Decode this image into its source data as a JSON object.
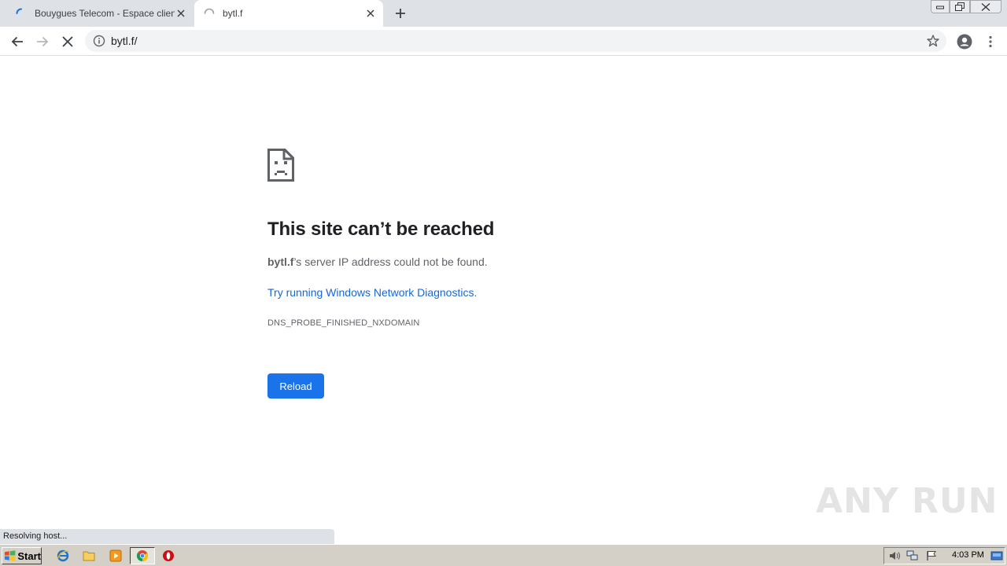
{
  "browser": {
    "tabs": [
      {
        "title": "Bouygues Telecom - Espace client",
        "loading": true
      },
      {
        "title": "bytl.f",
        "loading": true,
        "active": true
      }
    ],
    "address_bar": {
      "url": "bytl.f/"
    }
  },
  "error_page": {
    "title": "This site can’t be reached",
    "host": "bytl.f",
    "message_suffix": "’s server IP address could not be found.",
    "link_text": "Try running Windows Network Diagnostics",
    "link_suffix": ".",
    "error_code": "DNS_PROBE_FINISHED_NXDOMAIN",
    "reload_label": "Reload"
  },
  "status_bar": {
    "text": "Resolving host..."
  },
  "watermark": {
    "text": "ANY RUN"
  },
  "taskbar": {
    "start_label": "Start",
    "clock": "4:03 PM"
  },
  "colors": {
    "tabstrip": "#dee1e6",
    "link": "#1967d2",
    "button": "#1a73e8",
    "taskbar": "#d4d0c8"
  }
}
